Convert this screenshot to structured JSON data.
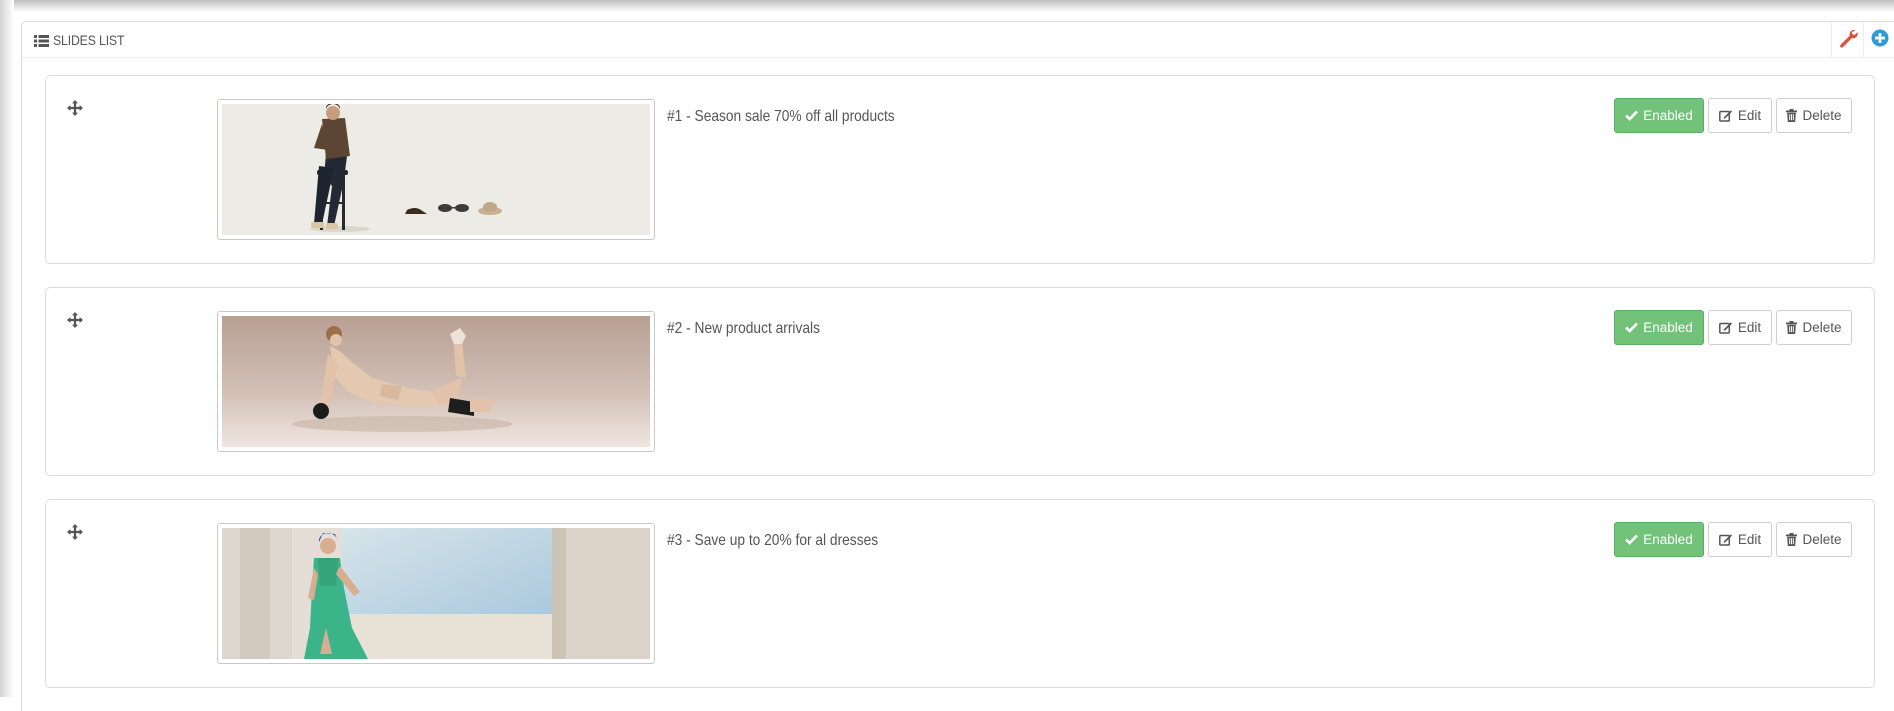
{
  "panel": {
    "title": "SLIDES LIST",
    "heading_icon": "list-icon",
    "tools": [
      {
        "name": "configure",
        "icon": "wrench-icon",
        "color": "#e0503f"
      },
      {
        "name": "add-new",
        "icon": "plus-circle-icon",
        "color": "#2e9bd9"
      }
    ]
  },
  "colors": {
    "enabled_green": "#72c279",
    "text": "#555555",
    "border": "#dcdcdc"
  },
  "slides": [
    {
      "title": "#1 - Season sale 70% off all products",
      "image": "man-on-stool-with-shoes-sunglasses-hat",
      "status": "Enabled",
      "edit": "Edit",
      "delete": "Delete"
    },
    {
      "title": "#2 - New product arrivals",
      "image": "reclining-woman-in-lingerie",
      "status": "Enabled",
      "edit": "Edit",
      "delete": "Delete"
    },
    {
      "title": "#3 - Save up to 20% for al dresses",
      "image": "woman-in-green-dress-by-window",
      "status": "Enabled",
      "edit": "Edit",
      "delete": "Delete"
    }
  ]
}
